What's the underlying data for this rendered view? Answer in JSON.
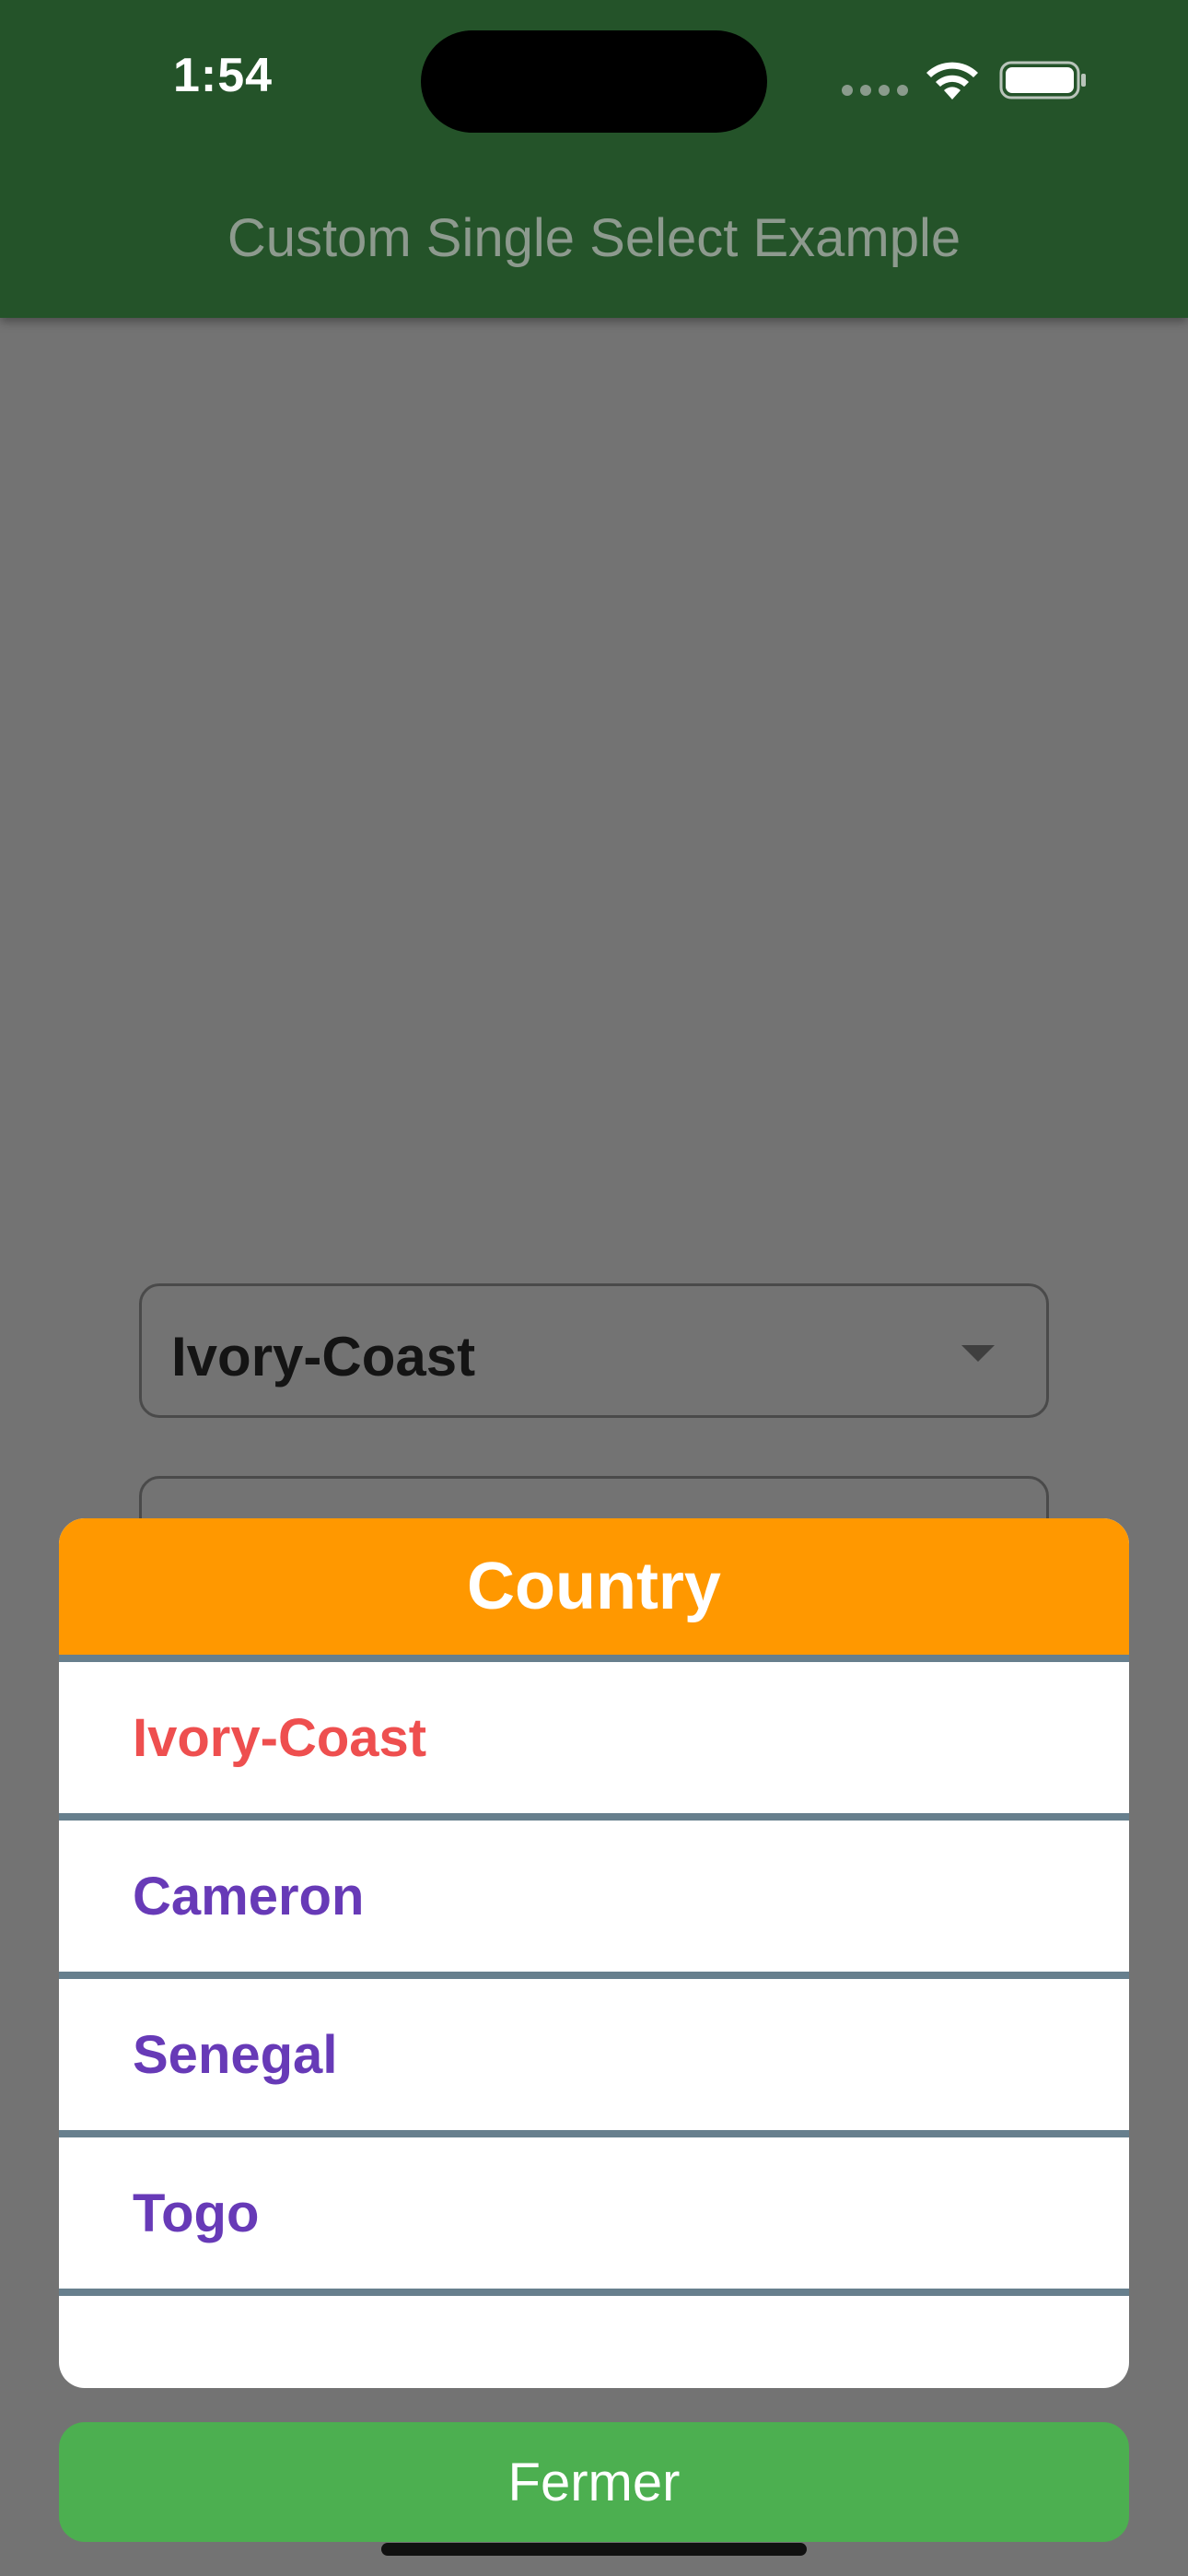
{
  "status_bar": {
    "time": "1:54"
  },
  "app_bar": {
    "title": "Custom Single Select Example"
  },
  "dropdown": {
    "value": "Ivory-Coast"
  },
  "dialog": {
    "title": "Country",
    "items": [
      {
        "label": "Ivory-Coast",
        "selected": true
      },
      {
        "label": "Cameron",
        "selected": false
      },
      {
        "label": "Senegal",
        "selected": false
      },
      {
        "label": "Togo",
        "selected": false
      }
    ],
    "close_label": "Fermer"
  },
  "colors": {
    "app_bar": "#245329",
    "dialog_header": "#ff9800",
    "selected_item": "#ee4f4f",
    "item": "#673ab7",
    "close_button": "#4caf50",
    "divider": "#677f8d"
  }
}
